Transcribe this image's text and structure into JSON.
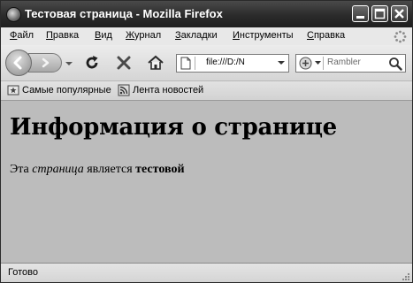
{
  "window": {
    "title": "Тестовая страница - Mozilla Firefox"
  },
  "menu": {
    "items": [
      {
        "underline": "Ф",
        "rest": "айл"
      },
      {
        "underline": "П",
        "rest": "равка"
      },
      {
        "underline": "В",
        "rest": "ид"
      },
      {
        "underline": "Ж",
        "rest": "урнал"
      },
      {
        "underline": "З",
        "rest": "акладки"
      },
      {
        "underline": "И",
        "rest": "нструменты"
      },
      {
        "underline": "С",
        "rest": "правка"
      }
    ]
  },
  "toolbar": {
    "url": "file:///D:/N",
    "search_engine": "Rambler",
    "icons": [
      "back-icon",
      "forward-icon",
      "reload-icon",
      "stop-icon",
      "home-icon",
      "search-icon"
    ]
  },
  "bookmarks": {
    "items": [
      {
        "label": "Самые популярные",
        "icon": "star-folder-icon"
      },
      {
        "label": "Лента новостей",
        "icon": "rss-feed-icon"
      }
    ]
  },
  "page": {
    "heading": "Информация о странице",
    "paragraph": {
      "part1": "Эта ",
      "italic": "страница",
      "part2": " является ",
      "bold": "тестовой"
    }
  },
  "status": {
    "text": "Готово"
  }
}
